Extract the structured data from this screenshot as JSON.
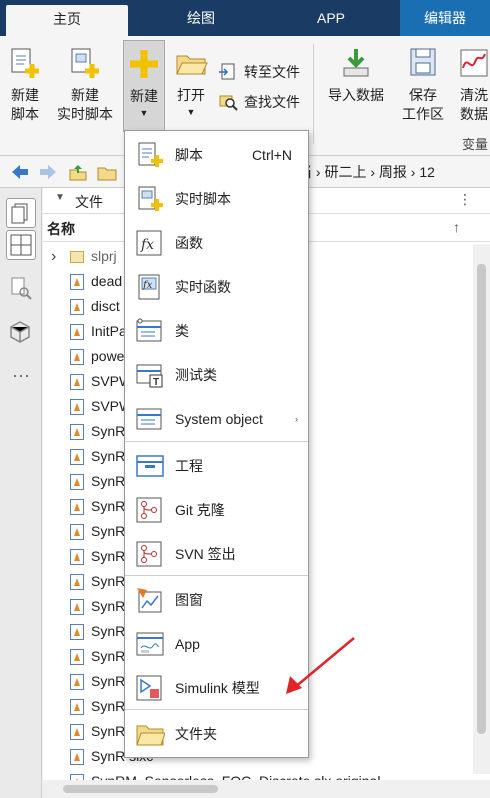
{
  "tabs": [
    "主页",
    "绘图",
    "APP",
    "编辑器"
  ],
  "ribbon": {
    "new_script": "新建\n脚本",
    "new_live_script": "新建\n实时脚本",
    "new": "新建",
    "open": "打开",
    "goto_file": "转至文件",
    "find_files": "查找文件",
    "import_data": "导入数据",
    "save_workspace": "保存\n工作区",
    "clean_data": "清洗\n数据",
    "variable_label": "变量"
  },
  "address": {
    "crumbs": "当 › 研二上 › 周报 › 12"
  },
  "file_panel": {
    "title": "文件",
    "column_name": "名称",
    "rows": [
      {
        "name": "slprj",
        "type": "folder"
      },
      {
        "name": "dead",
        "type": "mat"
      },
      {
        "name": "disct",
        "type": "mat"
      },
      {
        "name": "InitPa",
        "type": "mat"
      },
      {
        "name": "powe",
        "type": "mat"
      },
      {
        "name": "SVPW",
        "type": "mat"
      },
      {
        "name": "SVPW",
        "type": "model"
      },
      {
        "name": "SynR",
        "type": "mat"
      },
      {
        "name": "SynR",
        "type": "model"
      },
      {
        "name": "SynR",
        "type": "mat"
      },
      {
        "name": "SynR",
        "type": "mat"
      },
      {
        "name": "SynR",
        "type": "mat"
      },
      {
        "name": "SynR",
        "type": "model"
      },
      {
        "name": "SynR",
        "type": "model"
      },
      {
        "name": "SynR",
        "type": "mat"
      },
      {
        "name": "SynR",
        "type": "model"
      },
      {
        "name": "SynR",
        "type": "mat"
      },
      {
        "name": "SynR",
        "type": "model"
      },
      {
        "name": "SynR",
        "type": "mat"
      },
      {
        "name": "SynR                              slx",
        "type": "model"
      },
      {
        "name": "SynR                              slxc",
        "type": "model"
      },
      {
        "name": "SynRM_Sensorless_FOC_Discrete.slx.original",
        "type": "model"
      }
    ]
  },
  "menu": {
    "items": [
      {
        "label": "脚本",
        "shortcut": "Ctrl+N",
        "icon": "script-icon"
      },
      {
        "label": "实时脚本",
        "icon": "live-script-icon"
      },
      {
        "label": "函数",
        "icon": "function-icon"
      },
      {
        "label": "实时函数",
        "icon": "live-function-icon"
      },
      {
        "label": "类",
        "icon": "class-icon"
      },
      {
        "label": "测试类",
        "icon": "test-class-icon"
      },
      {
        "label": "System object",
        "icon": "system-object-icon",
        "submenu": "›"
      },
      {
        "label": "工程",
        "icon": "project-icon"
      },
      {
        "label": "Git 克隆",
        "icon": "git-clone-icon"
      },
      {
        "label": "SVN 签出",
        "icon": "svn-checkout-icon"
      },
      {
        "label": "图窗",
        "icon": "figure-icon"
      },
      {
        "label": "App",
        "icon": "app-icon"
      },
      {
        "label": "Simulink 模型",
        "icon": "simulink-model-icon"
      },
      {
        "label": "文件夹",
        "icon": "folder-icon"
      }
    ]
  },
  "colors": {
    "tabbar": "#1a3b63",
    "editor_tab": "#1a6fb3",
    "arrow": "#e0242a"
  }
}
